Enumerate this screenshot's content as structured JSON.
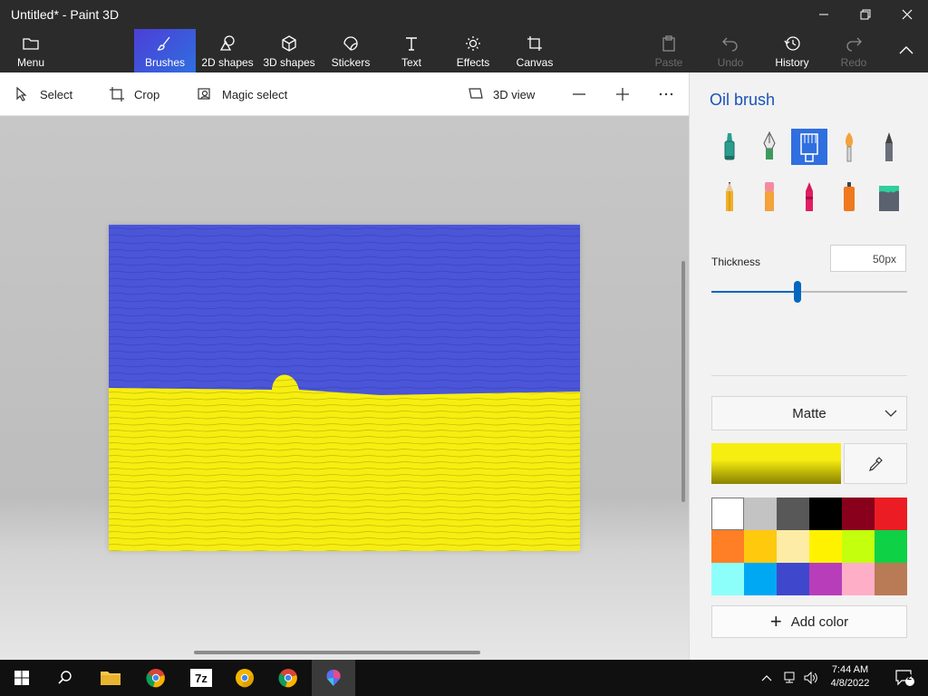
{
  "window": {
    "title": "Untitled* - Paint 3D"
  },
  "ribbon": {
    "menu": "Menu",
    "brushes": "Brushes",
    "shapes2d": "2D shapes",
    "shapes3d": "3D shapes",
    "stickers": "Stickers",
    "text": "Text",
    "effects": "Effects",
    "canvas": "Canvas",
    "paste": "Paste",
    "undo": "Undo",
    "history": "History",
    "redo": "Redo"
  },
  "toolbar": {
    "select": "Select",
    "crop": "Crop",
    "magic_select": "Magic select",
    "view3d": "3D view"
  },
  "panel": {
    "title": "Oil brush",
    "brushes": [
      "marker",
      "calligraphy-pen",
      "oil-brush",
      "watercolor",
      "pixel-pen",
      "pencil",
      "eraser",
      "crayon",
      "spray-can",
      "fill"
    ],
    "selected_brush": "oil-brush",
    "thickness_label": "Thickness",
    "thickness_value": "50px",
    "thickness_fraction": 0.44,
    "finish": "Matte",
    "current_color": "#f7ee11",
    "add_color": "Add color",
    "palette": [
      "#ffffff",
      "#c3c3c3",
      "#585858",
      "#000000",
      "#88001b",
      "#ec1c24",
      "#ff7f27",
      "#ffc90e",
      "#fdeca6",
      "#fff200",
      "#c4ff0e",
      "#0ed145",
      "#8cfffb",
      "#00a8f3",
      "#3f48cc",
      "#b83dba",
      "#ffaec8",
      "#b97a56"
    ]
  },
  "drawing": {
    "top_color": "#4a55d8",
    "bottom_color": "#f7ee11"
  },
  "taskbar": {
    "time": "7:44 AM",
    "date": "4/8/2022",
    "notifications": "2"
  }
}
